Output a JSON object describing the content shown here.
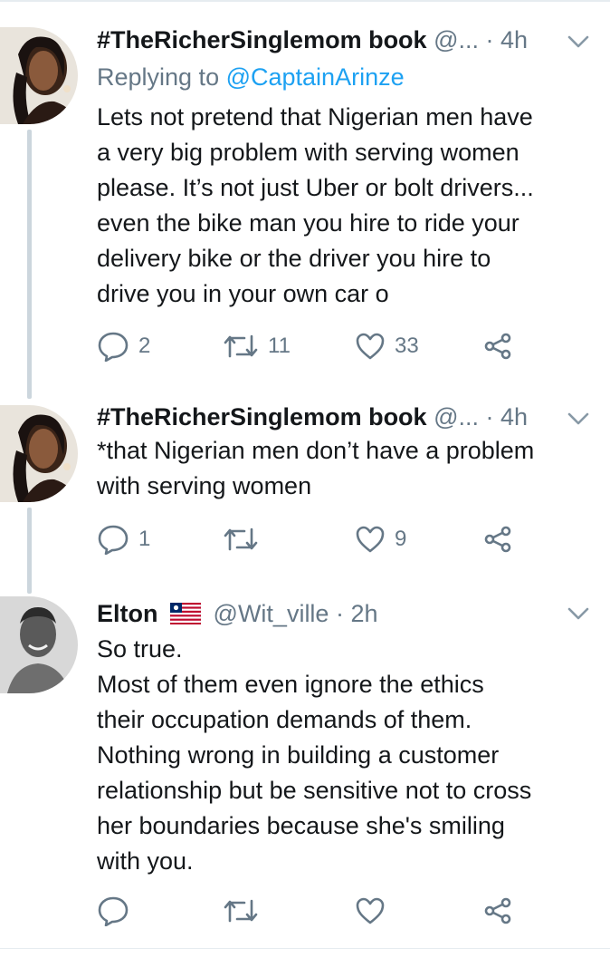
{
  "tweets": [
    {
      "name": "#TheRicherSinglemom book",
      "handle": "@...",
      "time": "4h",
      "reply_prefix": "Replying to ",
      "reply_to": "@CaptainArinze",
      "text": "Lets not pretend that Nigerian men have\na very big problem with serving women\nplease. It’s not just Uber or bolt drivers...\neven the bike man you hire to ride your\ndelivery bike or the driver you hire to\ndrive you in your own car o",
      "replies": "2",
      "retweets": "11",
      "likes": "33"
    },
    {
      "name": "#TheRicherSinglemom book",
      "handle": "@...",
      "time": "4h",
      "text": "*that Nigerian men don’t have a problem\nwith serving women",
      "replies": "1",
      "retweets": "",
      "likes": "9"
    },
    {
      "name": "Elton",
      "flag": "🇱🇷",
      "handle": "@Wit_ville",
      "time": "2h",
      "text": "So true.\nMost of them even ignore the ethics\ntheir occupation demands of them.\nNothing wrong in building a customer\nrelationship but be sensitive not to cross\nher boundaries because she's smiling\nwith you.",
      "replies": "",
      "retweets": "",
      "likes": ""
    }
  ],
  "colors": {
    "link": "#1da1f2",
    "secondary": "#657786",
    "text": "#14171a",
    "thread_line": "#ccd6dd"
  },
  "icons": [
    "reply-icon",
    "retweet-icon",
    "like-icon",
    "share-icon",
    "chevron-down-icon",
    "flag-liberia-icon"
  ]
}
